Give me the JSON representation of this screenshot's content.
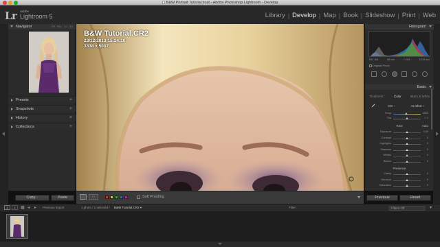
{
  "window": {
    "title": "B&W Portrait Tutorial.lrcat - Adobe Photoshop Lightroom - Develop"
  },
  "header": {
    "logo": "Lr",
    "brand_small": "Adobe",
    "brand_name": "Lightroom 5",
    "modules": [
      {
        "label": "Library",
        "active": false
      },
      {
        "label": "Develop",
        "active": true
      },
      {
        "label": "Map",
        "active": false
      },
      {
        "label": "Book",
        "active": false
      },
      {
        "label": "Slideshow",
        "active": false
      },
      {
        "label": "Print",
        "active": false
      },
      {
        "label": "Web",
        "active": false
      }
    ],
    "separator": "|"
  },
  "left_panel": {
    "navigator": {
      "title": "Navigator",
      "zoom_options": [
        "FIT",
        "FILL",
        "1:1",
        "3:1"
      ]
    },
    "sections": [
      {
        "label": "Presets",
        "plus": "+"
      },
      {
        "label": "Snapshots",
        "plus": "+"
      },
      {
        "label": "History",
        "plus": "×"
      },
      {
        "label": "Collections",
        "plus": "+"
      }
    ],
    "copy_button": "Copy...",
    "paste_button": "Paste"
  },
  "image_overlay": {
    "filename": "B&W Tutorial.CR2",
    "date": "23/12/2013 15:24:10",
    "dimensions": "3338 x 5007"
  },
  "toolbar": {
    "soft_proofing": "Soft Proofing",
    "colors": [
      "#c33",
      "#cc3",
      "#3a3",
      "#36c",
      "#939"
    ]
  },
  "right_panel": {
    "histogram": {
      "title": "Histogram",
      "readout": [
        "ISO 100",
        "85 mm",
        "f / 5.6",
        "1/125 sec"
      ],
      "original_photo": "Original Photo"
    },
    "basic": {
      "title": "Basic",
      "treatment_label": "Treatment :",
      "color": "Color",
      "bw": "Black & White",
      "wb_label": "WB :",
      "wb_value": "As Shot ÷",
      "temp": {
        "label": "Temp",
        "value": "4800",
        "position": 0.47
      },
      "tint": {
        "label": "Tint",
        "value": "+ 1",
        "position": 0.5
      },
      "tone_label": "Tone",
      "auto": "Auto",
      "tone_sliders": [
        {
          "label": "Exposure",
          "value": "0.00",
          "position": 0.5
        },
        {
          "label": "Contrast",
          "value": "0",
          "position": 0.5
        },
        {
          "label": "Highlights",
          "value": "0",
          "position": 0.5
        },
        {
          "label": "Shadows",
          "value": "0",
          "position": 0.5
        },
        {
          "label": "Whites",
          "value": "0",
          "position": 0.5
        },
        {
          "label": "Blacks",
          "value": "0",
          "position": 0.5
        }
      ],
      "presence_label": "Presence",
      "presence_sliders": [
        {
          "label": "Clarity",
          "value": "0",
          "position": 0.5
        },
        {
          "label": "Vibrance",
          "value": "0",
          "position": 0.5
        },
        {
          "label": "Saturation",
          "value": "0",
          "position": 0.5
        }
      ]
    },
    "previous_button": "Previous",
    "reset_button": "Reset"
  },
  "filmstrip_bar": {
    "page1": "1",
    "page2": "2",
    "previous_import": "Previous Import",
    "selection": "1 photo / 1 selected /",
    "filename": "B&W Tutorial.CR2 ▾",
    "filter_label": "Filter :",
    "filters_off": "Filters Off"
  }
}
